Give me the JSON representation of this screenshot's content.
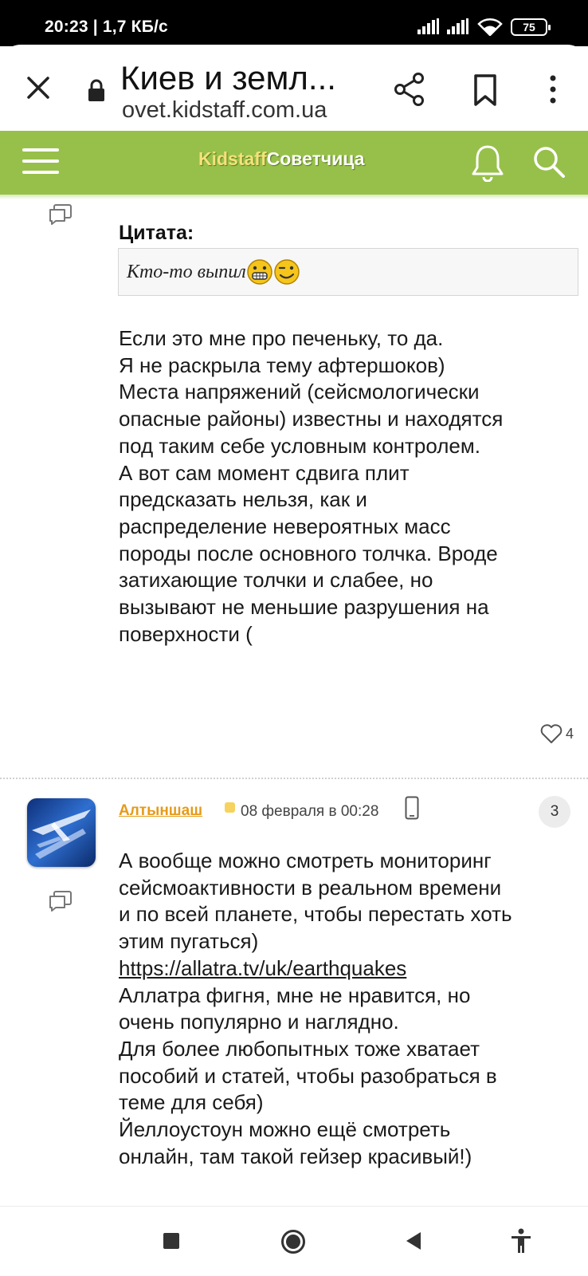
{
  "status_bar": {
    "time": "20:23 | 1,7 КБ/с",
    "battery": "75"
  },
  "browser": {
    "tab_title": "Киев и земл...",
    "url": "ovet.kidstaff.com.ua"
  },
  "site_header": {
    "logo_part1": "Kidstaff",
    "logo_part2": "Советчица",
    "accent_color": "#97c04a"
  },
  "post1": {
    "quote_label": "Цитата:",
    "quote_text": "Кто-то выпил",
    "body_lines": [
      "Если это мне про печеньку, то да.",
      "Я не раскрыла тему афтершоков)",
      "Места напряжений (сейсмологически",
      "опасные районы) известны и находятся",
      "под таким себе условным контролем.",
      "А вот сам момент сдвига плит",
      "предсказать нельзя, как и",
      "распределение невероятных масс",
      "породы после основного толчка. Вроде",
      "затихающие толчки и слабее, но",
      "вызывают не меньшие разрушения на",
      "поверхности ("
    ],
    "likes": "4"
  },
  "post2": {
    "author": "Алтыншаш",
    "author_color": "#e69a18",
    "date": "08 февраля в 00:28",
    "post_number": "3",
    "body_lines": [
      "А вообще можно смотреть мониторинг",
      "сейсмоактивности в реальном времени",
      "и по всей планете, чтобы перестать хоть",
      "этим пугаться)"
    ],
    "link": "https://allatra.tv/uk/earthquakes",
    "body_lines_after": [
      "Аллатра фигня, мне не нравится, но",
      "очень популярно и наглядно.",
      "Для более любопытных тоже хватает",
      "пособий и статей, чтобы разобраться в",
      "теме для себя)",
      "Йеллоустоун можно ещё смотреть",
      "онлайн, там такой гейзер красивый!)"
    ]
  }
}
